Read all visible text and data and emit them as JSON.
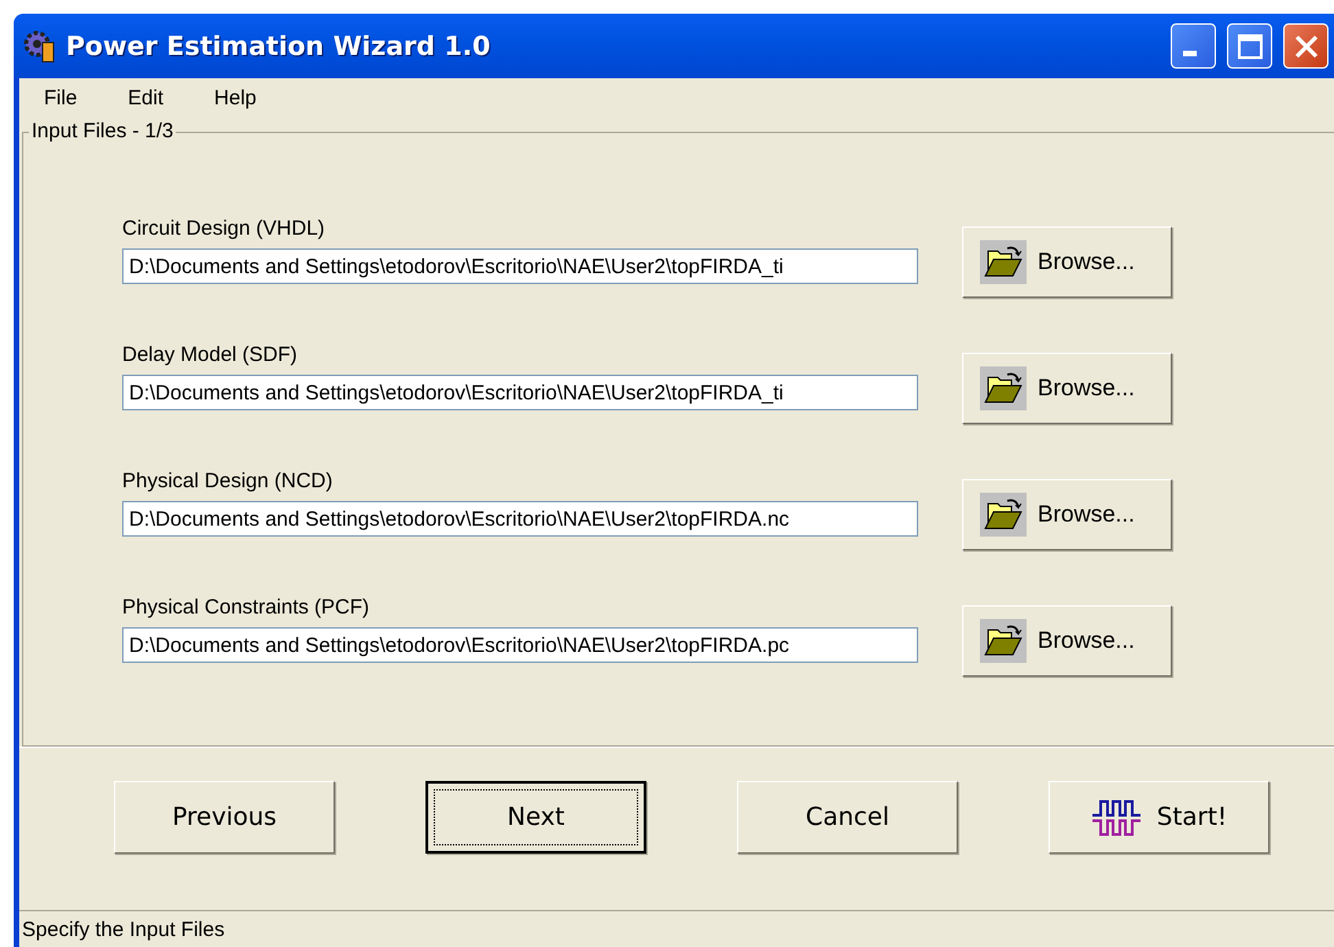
{
  "window": {
    "title": "Power Estimation Wizard 1.0"
  },
  "menu": [
    {
      "label": "File"
    },
    {
      "label": "Edit"
    },
    {
      "label": "Help"
    }
  ],
  "group": {
    "title": "Input Files - 1/3",
    "files": [
      {
        "label": "Circuit Design (VHDL)",
        "value": "D:\\Documents and Settings\\etodorov\\Escritorio\\NAE\\User2\\topFIRDA_ti",
        "button": "Browse..."
      },
      {
        "label": "Delay Model (SDF)",
        "value": "D:\\Documents and Settings\\etodorov\\Escritorio\\NAE\\User2\\topFIRDA_ti",
        "button": "Browse..."
      },
      {
        "label": "Physical Design (NCD)",
        "value": "D:\\Documents and Settings\\etodorov\\Escritorio\\NAE\\User2\\topFIRDA.nc",
        "button": "Browse..."
      },
      {
        "label": "Physical Constraints (PCF)",
        "value": "D:\\Documents and Settings\\etodorov\\Escritorio\\NAE\\User2\\topFIRDA.pc",
        "button": "Browse..."
      }
    ]
  },
  "buttons": [
    {
      "label": "Previous",
      "focused": false,
      "kind": "plain"
    },
    {
      "label": "Next",
      "focused": true,
      "kind": "plain"
    },
    {
      "label": "Cancel",
      "focused": false,
      "kind": "plain"
    },
    {
      "label": "Start!",
      "focused": false,
      "kind": "start"
    }
  ],
  "status_bar": "Specify the Input Files"
}
